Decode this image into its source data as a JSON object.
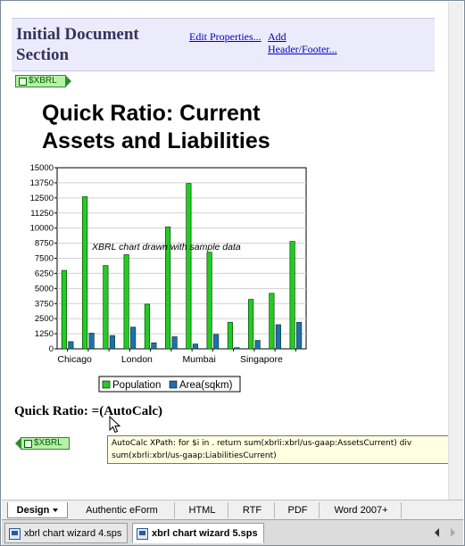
{
  "section": {
    "title": "Initial Document Section",
    "edit_properties": "Edit Properties...",
    "add_header_footer": "Add Header/Footer..."
  },
  "xbrl_tag": "$XBRL",
  "heading": "Quick Ratio: Current Assets and Liabilities",
  "quick_ratio": "Quick Ratio: =(AutoCalc)",
  "tooltip": "AutoCalc XPath: for $i in . return sum(xbrli:xbrl/us-gaap:AssetsCurrent) div sum(xbrli:xbrl/us-gaap:LiabilitiesCurrent)",
  "view_tabs": [
    "Design",
    "Authentic eForm",
    "HTML",
    "RTF",
    "PDF",
    "Word 2007+"
  ],
  "doc_tabs": [
    "xbrl chart wizard 4.sps",
    "xbrl chart wizard 5.sps"
  ],
  "colors": {
    "population": "#22cc22",
    "area": "#1f6fb5",
    "tooltip_bg": "#ffffe1"
  },
  "chart_data": {
    "type": "bar",
    "annotation": "XBRL chart drawn with sample data",
    "x_tick_labels": [
      "Chicago",
      "London",
      "Mumbai",
      "Singapore"
    ],
    "categories": [
      "Chicago",
      "",
      "",
      "London",
      "",
      "",
      "Mumbai",
      "",
      "",
      "Singapore",
      "",
      ""
    ],
    "series": [
      {
        "name": "Population",
        "values": [
          6500,
          12600,
          6900,
          7800,
          3700,
          10100,
          13700,
          8000,
          2200,
          4100,
          4600,
          8900
        ]
      },
      {
        "name": "Area(sqkm)",
        "values": [
          600,
          1300,
          1100,
          1800,
          500,
          1000,
          400,
          1200,
          100,
          700,
          2000,
          2200
        ]
      }
    ],
    "ylim": [
      0,
      15000
    ],
    "yticks": [
      "0",
      "1250",
      "2500",
      "3750",
      "5000",
      "6250",
      "7500",
      "8750",
      "10000",
      "11250",
      "12500",
      "13750",
      "15000"
    ],
    "grid": true,
    "legend": "bottom"
  }
}
